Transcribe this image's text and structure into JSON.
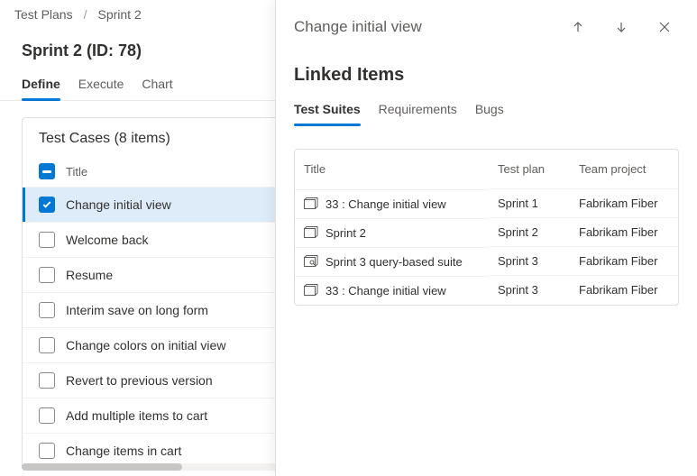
{
  "breadcrumb": {
    "root": "Test Plans",
    "current": "Sprint 2"
  },
  "page_title": "Sprint 2 (ID: 78)",
  "main_tabs": {
    "define": "Define",
    "execute": "Execute",
    "chart": "Chart"
  },
  "testcases": {
    "header": "Test Cases (8 items)",
    "col_title": "Title",
    "items": [
      {
        "title": "Change initial view",
        "selected": true
      },
      {
        "title": "Welcome back",
        "selected": false
      },
      {
        "title": "Resume",
        "selected": false
      },
      {
        "title": "Interim save on long form",
        "selected": false
      },
      {
        "title": "Change colors on initial view",
        "selected": false
      },
      {
        "title": "Revert to previous version",
        "selected": false
      },
      {
        "title": "Add multiple items to cart",
        "selected": false
      },
      {
        "title": "Change items in cart",
        "selected": false
      }
    ]
  },
  "panel": {
    "title": "Change initial view",
    "section": "Linked Items",
    "tabs": {
      "suites": "Test Suites",
      "reqs": "Requirements",
      "bugs": "Bugs"
    },
    "columns": {
      "title": "Title",
      "plan": "Test plan",
      "project": "Team project"
    },
    "rows": [
      {
        "title": "33 : Change initial view",
        "plan": "Sprint 1",
        "project": "Fabrikam Fiber",
        "icon": "static"
      },
      {
        "title": "Sprint 2",
        "plan": "Sprint 2",
        "project": "Fabrikam Fiber",
        "icon": "static"
      },
      {
        "title": "Sprint 3 query-based suite",
        "plan": "Sprint 3",
        "project": "Fabrikam Fiber",
        "icon": "query"
      },
      {
        "title": "33 : Change initial view",
        "plan": "Sprint 3",
        "project": "Fabrikam Fiber",
        "icon": "static"
      }
    ]
  }
}
